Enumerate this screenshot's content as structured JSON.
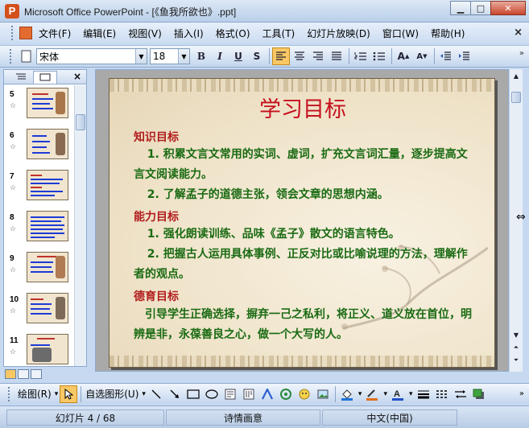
{
  "window": {
    "title": "Microsoft Office PowerPoint - [《鱼我所欲也》.ppt]",
    "app_icon_letter": "P",
    "minimize": "▁",
    "maximize": "□",
    "close": "✕"
  },
  "menu": {
    "items": [
      {
        "label": "文件(F)"
      },
      {
        "label": "编辑(E)"
      },
      {
        "label": "视图(V)"
      },
      {
        "label": "插入(I)"
      },
      {
        "label": "格式(O)"
      },
      {
        "label": "工具(T)"
      },
      {
        "label": "幻灯片放映(D)"
      },
      {
        "label": "窗口(W)"
      },
      {
        "label": "帮助(H)"
      }
    ],
    "close": "×"
  },
  "format_toolbar": {
    "font_name": "宋体",
    "font_size": "18",
    "bold": "B",
    "italic": "I",
    "underline": "U",
    "shadow": "S"
  },
  "slide_pane": {
    "close": "×",
    "thumbnails": [
      {
        "number": "5"
      },
      {
        "number": "6"
      },
      {
        "number": "7"
      },
      {
        "number": "8"
      },
      {
        "number": "9"
      },
      {
        "number": "10"
      },
      {
        "number": "11"
      }
    ]
  },
  "slide": {
    "title": "学习目标",
    "sections": [
      {
        "heading": "知识目标",
        "paragraphs": [
          "1. 积累文言文常用的实词、虚词，扩充文言词汇量，逐步提高文言文阅读能力。",
          "2. 了解孟子的道德主张，领会文章的思想内涵。"
        ]
      },
      {
        "heading": "能力目标",
        "paragraphs": [
          "1. 强化朗读训练、品味《孟子》散文的语言特色。",
          "2. 把握古人运用具体事例、正反对比或比喻说理的方法，理解作者的观点。"
        ]
      },
      {
        "heading": "德育目标",
        "paragraphs": [
          "引导学生正确选择，摒弃一己之私利，将正义、道义放在首位，明辨是非，永葆善良之心，做一个大写的人。"
        ]
      }
    ]
  },
  "draw_toolbar": {
    "draw_label": "绘图(R)",
    "autoshape_label": "自选图形(U)"
  },
  "status": {
    "slide_info": "幻灯片 4 / 68",
    "design": "诗情画意",
    "language": "中文(中国)"
  },
  "colors": {
    "title_red": "#c5101e",
    "heading_red": "#b11d1d",
    "body_green": "#1a6b13"
  }
}
